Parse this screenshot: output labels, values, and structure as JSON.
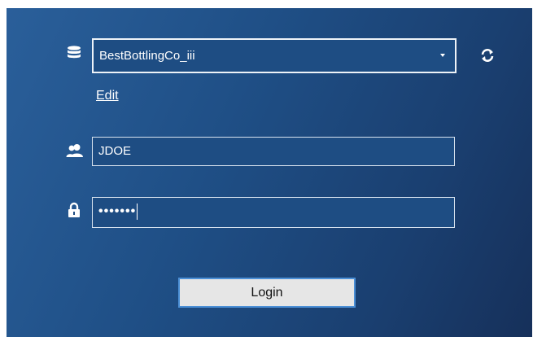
{
  "database": {
    "selected": "BestBottlingCo_iii",
    "icon": "database-icon",
    "refresh_icon": "refresh-icon"
  },
  "edit": {
    "label": "Edit"
  },
  "user": {
    "icon": "users-icon",
    "value": "JDOE"
  },
  "password": {
    "icon": "lock-icon",
    "masked_value": "•••••••"
  },
  "login": {
    "label": "Login"
  },
  "colors": {
    "panel_start": "#2a5f9a",
    "panel_end": "#16305a",
    "button_border": "#4b8fd6"
  }
}
